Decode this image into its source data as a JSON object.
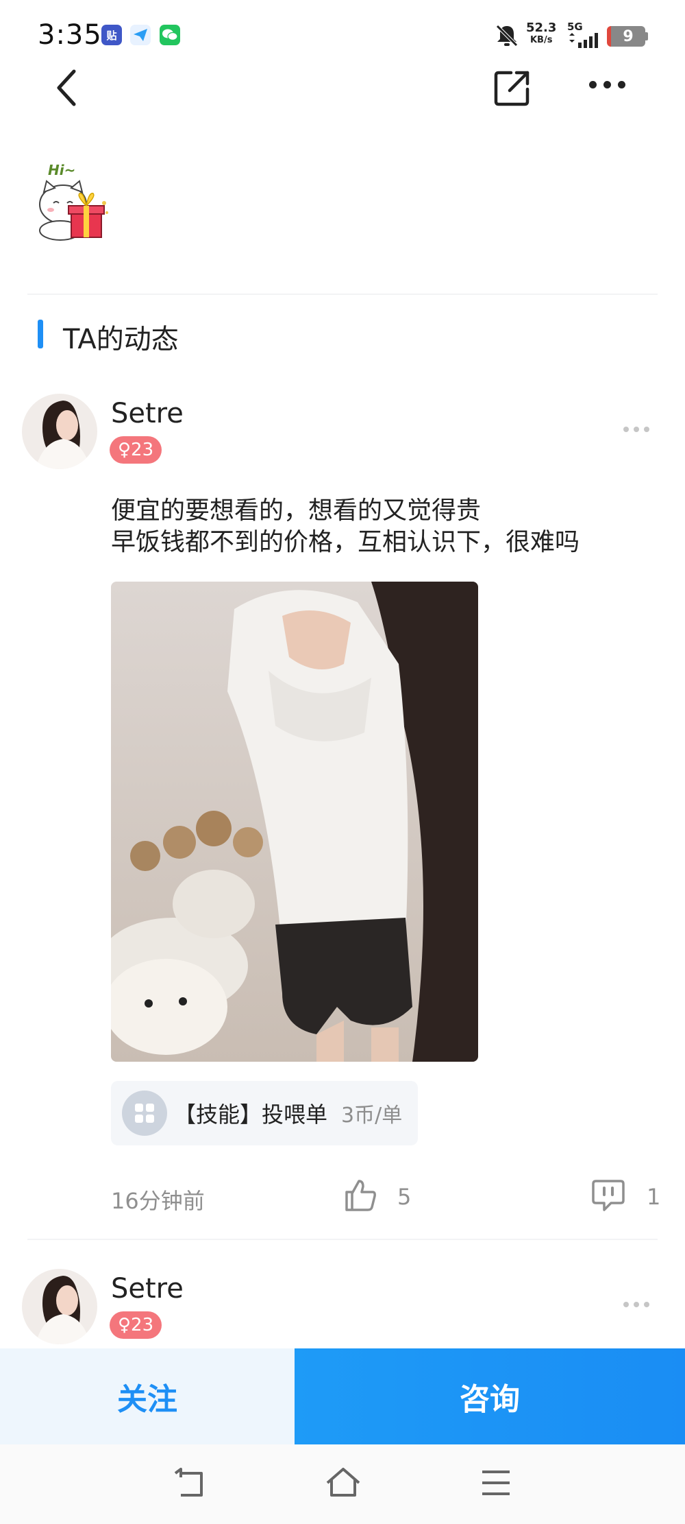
{
  "status_bar": {
    "time": "3:35",
    "app_badges": [
      "贴",
      "send-icon",
      "wechat-icon"
    ],
    "net_speed_value": "52.3",
    "net_speed_unit": "KB/s",
    "network_label": "5G",
    "battery_level": "9",
    "colors": {
      "battery_low": "#e0473c"
    }
  },
  "header": {
    "back_icon": "chevron-left-icon",
    "share_icon": "share-icon",
    "more_icon": "more-horizontal-icon"
  },
  "sticker": {
    "text": "Hi~",
    "icon": "cat-gift-sticker"
  },
  "section": {
    "title": "TA的动态"
  },
  "posts": [
    {
      "username": "Setre",
      "gender_age": "♀23",
      "text": "便宜的要想看的，想看的又觉得贵\n早饭钱都不到的价格，互相认识下，很难吗",
      "skill": {
        "label": "【技能】投喂单",
        "price": "3币/单"
      },
      "time_ago": "16分钟前",
      "likes": "5",
      "comments": "1"
    },
    {
      "username": "Setre",
      "gender_age": "♀23"
    }
  ],
  "actions": {
    "follow": "关注",
    "consult": "咨询"
  },
  "colors": {
    "accent": "#1e8ff5",
    "badge": "#f4767c"
  },
  "nav": {
    "icons": [
      "back-nav-icon",
      "home-nav-icon",
      "menu-nav-icon"
    ]
  }
}
